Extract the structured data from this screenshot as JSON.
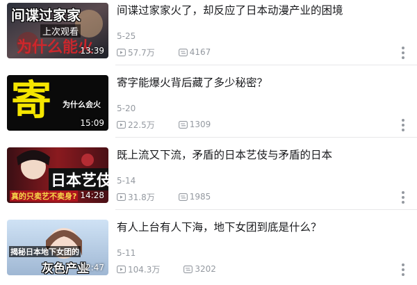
{
  "items": [
    {
      "title": "间谍过家家火了，却反应了日本动漫产业的困境",
      "date": "5-25",
      "views": "57.7万",
      "comments": "4167",
      "duration": "13:39",
      "thumb_text": [
        "间谍过家家",
        "上次观看",
        "为什么能火"
      ]
    },
    {
      "title": "寄字能爆火背后藏了多少秘密？",
      "date": "5-20",
      "views": "22.5万",
      "comments": "1309",
      "duration": "15:09",
      "thumb_text": [
        "寄",
        "为什么会火"
      ]
    },
    {
      "title": "既上流又下流，矛盾的日本艺伎与矛盾的日本",
      "date": "5-14",
      "views": "31.8万",
      "comments": "1985",
      "duration": "14:28",
      "thumb_text": [
        "日本艺伎",
        "真的只卖艺不卖身?"
      ]
    },
    {
      "title": "有人上台有人下海，地下女团到底是什么？",
      "date": "5-11",
      "views": "104.3万",
      "comments": "3202",
      "duration": "12:47",
      "thumb_text": [
        "揭秘日本地下女团的",
        "灰色产业"
      ]
    }
  ],
  "colors": {
    "text_primary": "#18191c",
    "text_secondary": "#9499a0",
    "divider": "#e7e7e9"
  },
  "icons": {
    "views": "play-count-icon",
    "comments": "danmaku-count-icon",
    "more": "more-vertical-icon"
  }
}
